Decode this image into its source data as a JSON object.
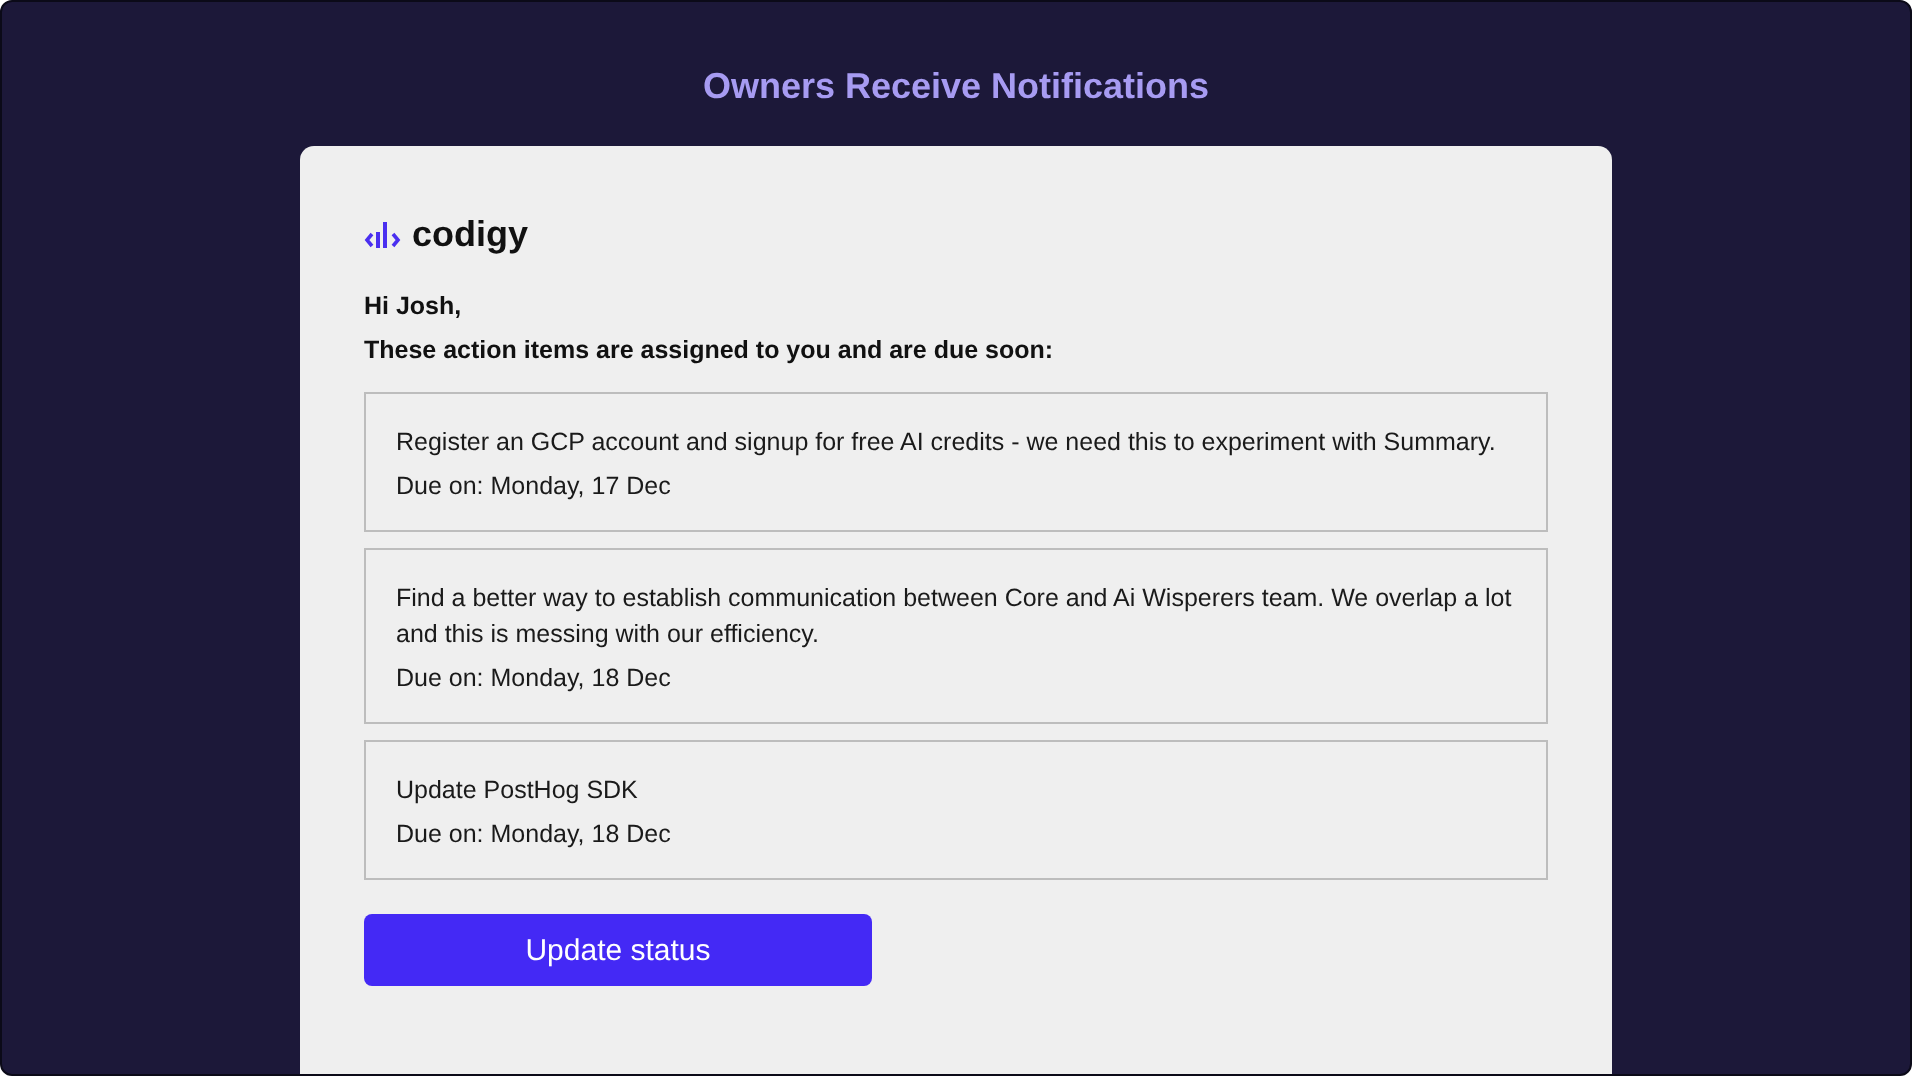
{
  "title": "Owners Receive Notifications",
  "email": {
    "brand": "codigy",
    "greeting": "Hi Josh,",
    "intro": "These action items are assigned to you and are due soon:",
    "items": [
      {
        "text": "Register an GCP account and signup for free AI credits - we need this to experiment with Summary.",
        "due": "Due on: Monday, 17 Dec"
      },
      {
        "text": "Find a better way to establish communication between Core and Ai Wisperers team. We overlap a lot and this is messing with our efficiency.",
        "due": "Due on: Monday, 18 Dec"
      },
      {
        "text": "Update PostHog SDK",
        "due": "Due on: Monday, 18 Dec"
      }
    ],
    "button": "Update status"
  }
}
